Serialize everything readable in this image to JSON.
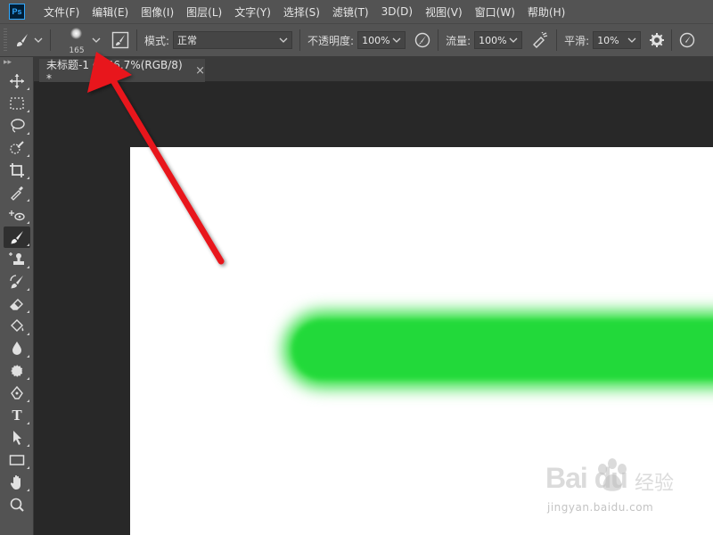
{
  "app": {
    "logo_text": "Ps"
  },
  "menu": [
    {
      "label": "文件(F)"
    },
    {
      "label": "编辑(E)"
    },
    {
      "label": "图像(I)"
    },
    {
      "label": "图层(L)"
    },
    {
      "label": "文字(Y)"
    },
    {
      "label": "选择(S)"
    },
    {
      "label": "滤镜(T)"
    },
    {
      "label": "3D(D)"
    },
    {
      "label": "视图(V)"
    },
    {
      "label": "窗口(W)"
    },
    {
      "label": "帮助(H)"
    }
  ],
  "options": {
    "brush_size": "165",
    "mode_label": "模式:",
    "mode_value": "正常",
    "opacity_label": "不透明度:",
    "opacity_value": "100%",
    "flow_label": "流量:",
    "flow_value": "100%",
    "smoothing_label": "平滑:",
    "smoothing_value": "10%"
  },
  "document": {
    "tab_title": "未标题-1 @ 66.7%(RGB/8) *",
    "close_glyph": "×",
    "stroke_color": "#22d93a"
  },
  "watermark": {
    "brand": "Bai  du",
    "brand_cn": "经验",
    "url": "jingyan.baidu.com"
  },
  "colors": {
    "accent_arrow": "#e8141b",
    "ui_bg": "#535353",
    "workspace_bg": "#282828"
  },
  "toolbar": {
    "tools": [
      {
        "icon": "move-tool-icon"
      },
      {
        "icon": "marquee-tool-icon"
      },
      {
        "icon": "lasso-tool-icon"
      },
      {
        "icon": "quick-selection-tool-icon"
      },
      {
        "icon": "crop-tool-icon"
      },
      {
        "icon": "eyedropper-tool-icon"
      },
      {
        "icon": "healing-brush-tool-icon"
      },
      {
        "icon": "brush-tool-icon",
        "active": true
      },
      {
        "icon": "clone-stamp-tool-icon"
      },
      {
        "icon": "history-brush-tool-icon"
      },
      {
        "icon": "eraser-tool-icon"
      },
      {
        "icon": "paint-bucket-tool-icon"
      },
      {
        "icon": "blur-tool-icon"
      },
      {
        "icon": "dodge-tool-icon"
      },
      {
        "icon": "pen-tool-icon"
      },
      {
        "icon": "type-tool-icon",
        "text": "T"
      },
      {
        "icon": "path-selection-tool-icon"
      },
      {
        "icon": "rectangle-tool-icon"
      },
      {
        "icon": "hand-tool-icon"
      },
      {
        "icon": "zoom-tool-icon"
      }
    ]
  }
}
